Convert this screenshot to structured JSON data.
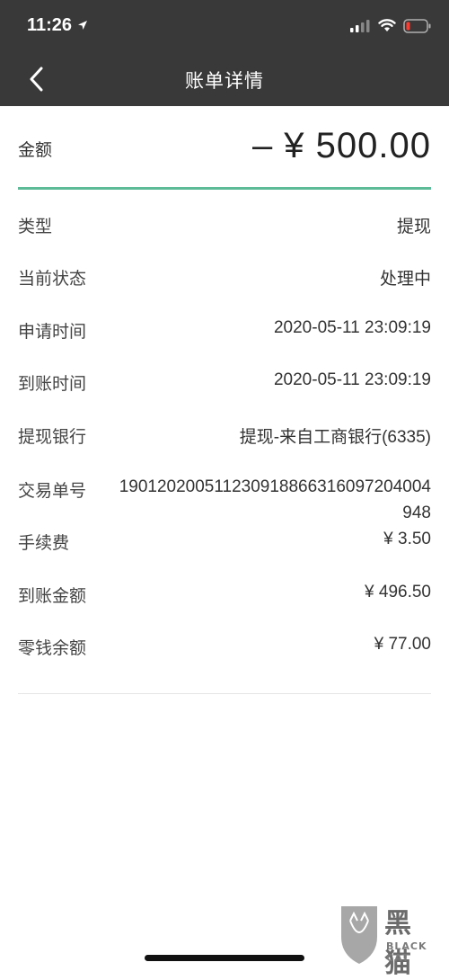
{
  "status_bar": {
    "time": "11:26"
  },
  "nav": {
    "title": "账单详情"
  },
  "amount": {
    "label": "金额",
    "value": "– ¥ 500.00"
  },
  "rows": [
    {
      "label": "类型",
      "value": "提现"
    },
    {
      "label": "当前状态",
      "value": "处理中"
    },
    {
      "label": "申请时间",
      "value": "2020-05-11 23:09:19"
    },
    {
      "label": "到账时间",
      "value": "2020-05-11 23:09:19"
    },
    {
      "label": "提现银行",
      "value": "提现-来自工商银行(6335)"
    },
    {
      "label": "交易单号",
      "value": "190120200511230918866316097204004948"
    },
    {
      "label": "手续费",
      "value": "¥ 3.50"
    },
    {
      "label": "到账金额",
      "value": "¥ 496.50"
    },
    {
      "label": "零钱余额",
      "value": "¥ 77.00"
    }
  ],
  "watermark": {
    "text": "黑猫",
    "sub": "BLACK CAT"
  },
  "colors": {
    "header": "#393939",
    "accent": "#5dbb98",
    "battery_low": "#ff3b30"
  }
}
